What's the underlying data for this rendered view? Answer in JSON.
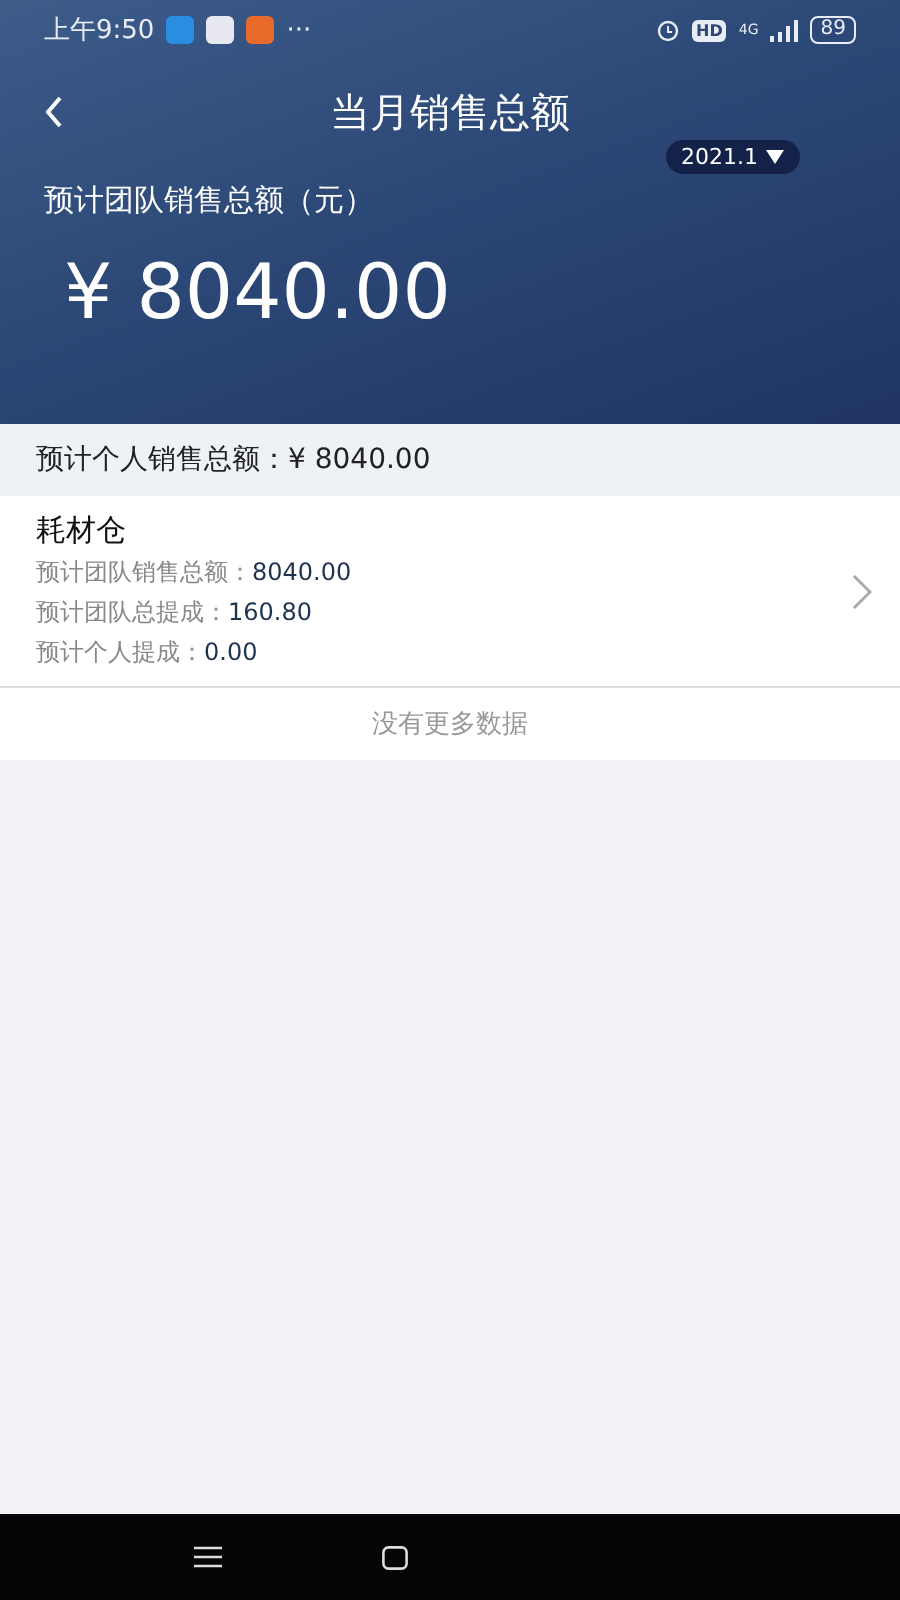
{
  "status_bar": {
    "time": "上午9:50",
    "more": "···",
    "hd": "HD",
    "network": "4G",
    "battery": "89"
  },
  "header": {
    "title": "当月销售总额",
    "period": "2021.1",
    "label": "预计团队销售总额（元）",
    "amount": "¥ 8040.00"
  },
  "personal_total": "预计个人销售总额：¥ 8040.00",
  "items": [
    {
      "name": "耗材仓",
      "lines": [
        {
          "label": "预计团队销售总额：",
          "value": "8040.00"
        },
        {
          "label": "预计团队总提成：",
          "value": "160.80"
        },
        {
          "label": "预计个人提成：",
          "value": "0.00"
        }
      ]
    }
  ],
  "footer_note": "没有更多数据"
}
